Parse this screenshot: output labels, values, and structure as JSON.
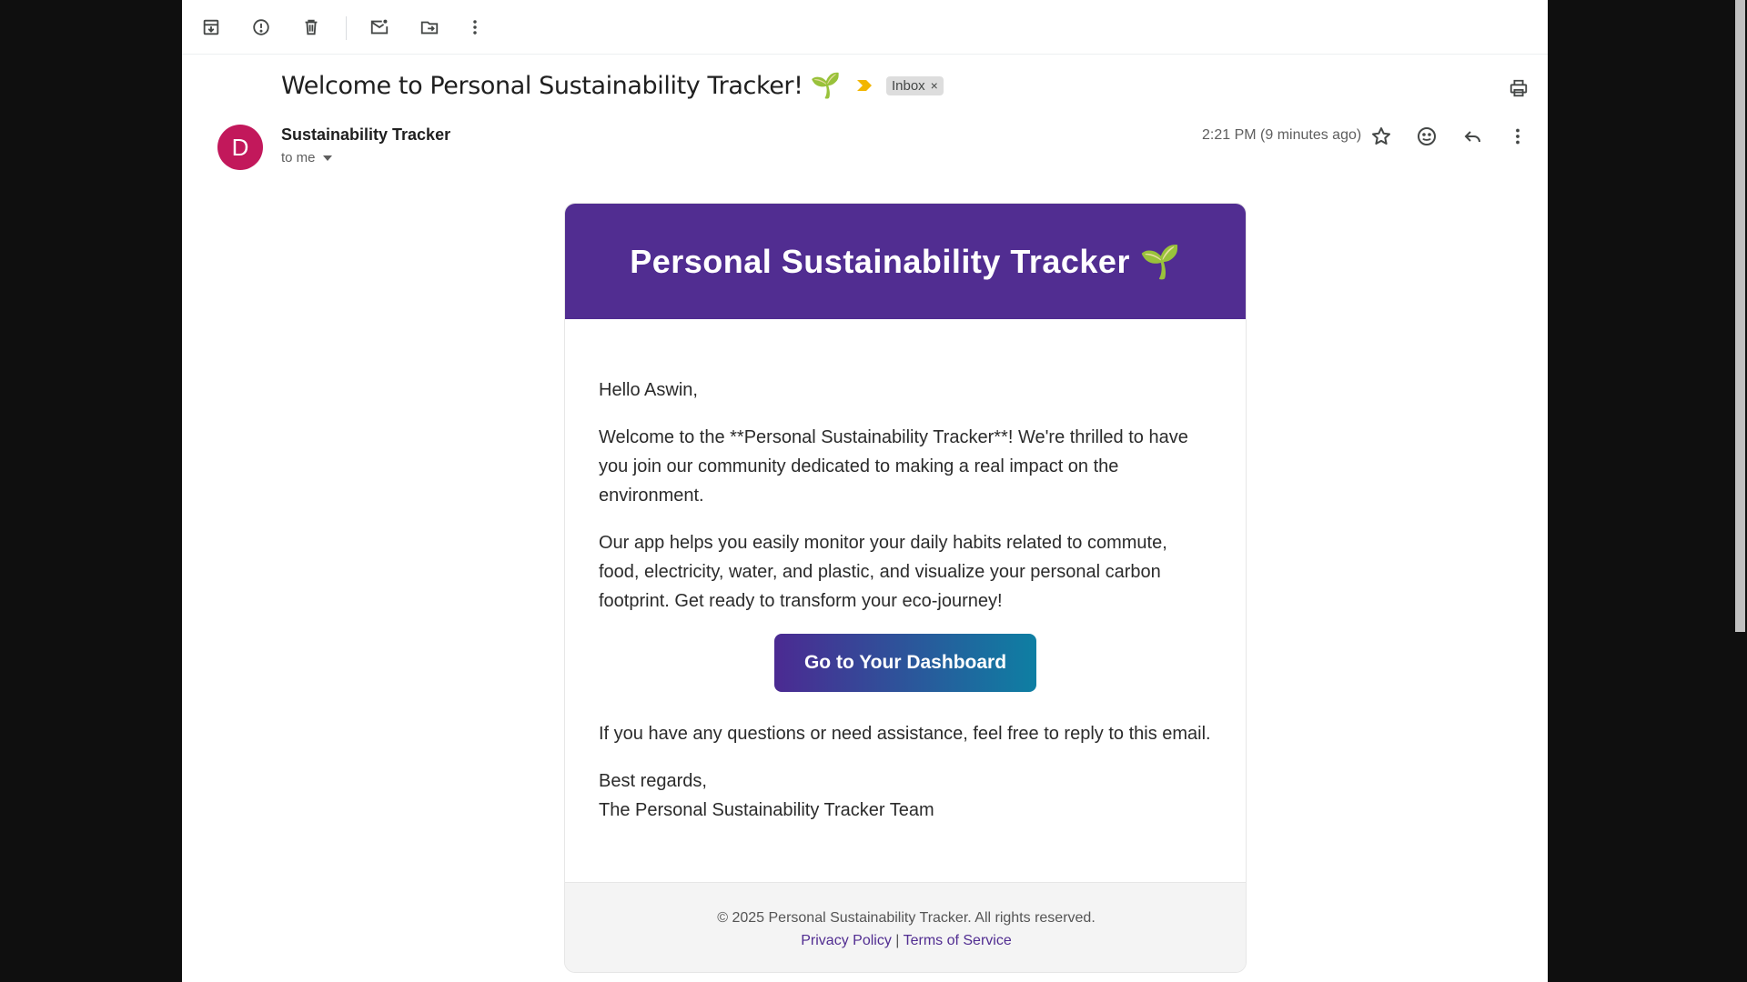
{
  "toolbar": {
    "icons": [
      "archive-icon",
      "report-spam-icon",
      "delete-icon",
      "mark-unread-icon",
      "move-to-icon",
      "more-vert-icon"
    ]
  },
  "message": {
    "subject": "Welcome to Personal Sustainability Tracker! 🌱",
    "label": "Inbox",
    "label_remove": "×",
    "sender_initial": "D",
    "sender_name": "Sustainability Tracker",
    "recipient": "to me",
    "timestamp": "2:21 PM (9 minutes ago)"
  },
  "email": {
    "header_title": "Personal Sustainability Tracker 🌱",
    "header_color": "#512d91",
    "greeting": "Hello Aswin,",
    "paragraph1": "Welcome to the **Personal Sustainability Tracker**! We're thrilled to have you join our community dedicated to making a real impact on the environment.",
    "paragraph2": "Our app helps you easily monitor your daily habits related to commute, food, electricity, water, and plastic, and visualize your personal carbon footprint. Get ready to transform your eco-journey!",
    "cta_label": "Go to Your Dashboard",
    "paragraph3": "If you have any questions or need assistance, feel free to reply to this email.",
    "signoff": "Best regards,",
    "signature": "The Personal Sustainability Tracker Team",
    "footer_copyright": "© 2025 Personal Sustainability Tracker. All rights reserved.",
    "privacy_link": "Privacy Policy",
    "link_separator": "|",
    "terms_link": "Terms of Service"
  }
}
